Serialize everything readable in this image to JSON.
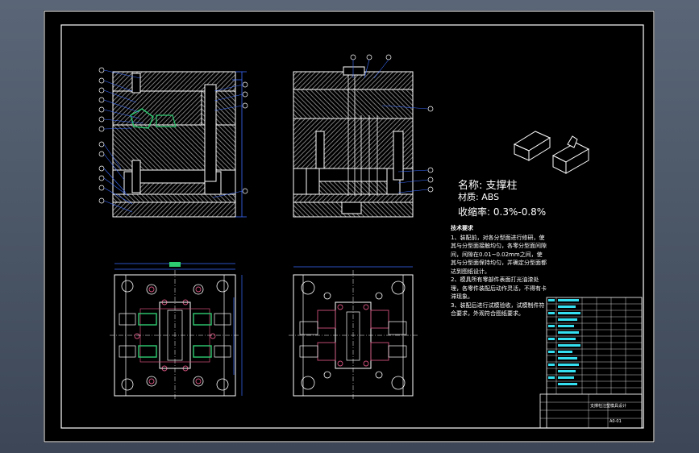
{
  "part": {
    "name_label": "名称:",
    "name_value": "支撑柱",
    "material_label": "材质:",
    "material_value": "ABS",
    "shrink_label": "收缩率:",
    "shrink_value": "0.3%-0.8%"
  },
  "requirements": {
    "title": "技术要求",
    "items": [
      "1、装配前，对各分型面进行修研，使其与分型面接触均匀，各零分型面间隙间，间隙在0.01~0.02mm之间，使其与分型面保持均匀，并确定分型面都达到图纸设计。",
      "2、模具所有零部件表面打光油漆处理，各零件装配后动作灵活，不得有卡滞现象。",
      "3、装配后进行试模验收，试模制件符合要求，外观符合图纸要求。"
    ]
  },
  "title_block": {
    "drawing_title": "支撑柱注塑模具设计",
    "drawing_no": "A0-01"
  },
  "colors": {
    "line": "#ffffff",
    "section_fill": "#bfbfbf",
    "cavity": "#2ecc71",
    "dimension": "#3b6cff",
    "leader": "#ffffff",
    "screw": "#d0507a",
    "table": "#34e0f0"
  }
}
